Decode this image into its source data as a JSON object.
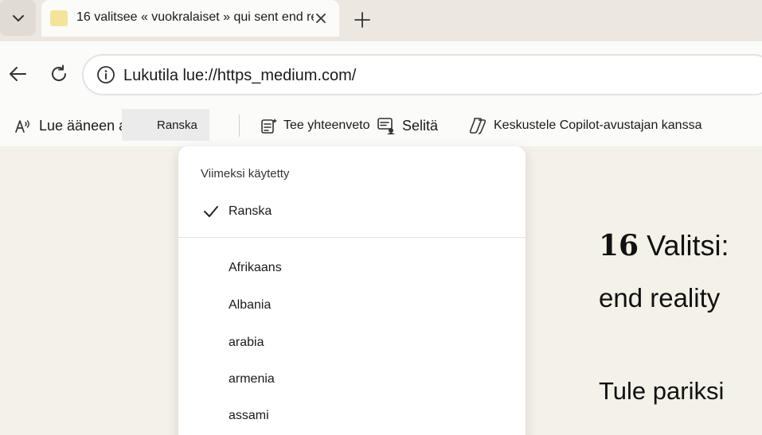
{
  "tab": {
    "title": "16 valitsee « vuokralaiset » qui sent end re"
  },
  "address": {
    "url": "Lukutila lue://https_medium.com/"
  },
  "reader_toolbar": {
    "read_aloud": "Lue ääneen ab",
    "language": "Ranska",
    "summarize": "Tee yhteenveto",
    "explain": "Selitä",
    "chat": "Keskustele Copilot-avustajan kanssa"
  },
  "dropdown": {
    "recent_heading": "Viimeksi käytetty",
    "recent_items": [
      {
        "label": "Ranska",
        "checked": true
      }
    ],
    "all_items": [
      {
        "label": "Afrikaans"
      },
      {
        "label": "Albania"
      },
      {
        "label": "arabia"
      },
      {
        "label": "armenia"
      },
      {
        "label": "assami"
      }
    ]
  },
  "article": {
    "title_number": "16",
    "title_text": "Valitsi:",
    "subtitle": "end reality",
    "paragraph": "Tule pariksi"
  }
}
